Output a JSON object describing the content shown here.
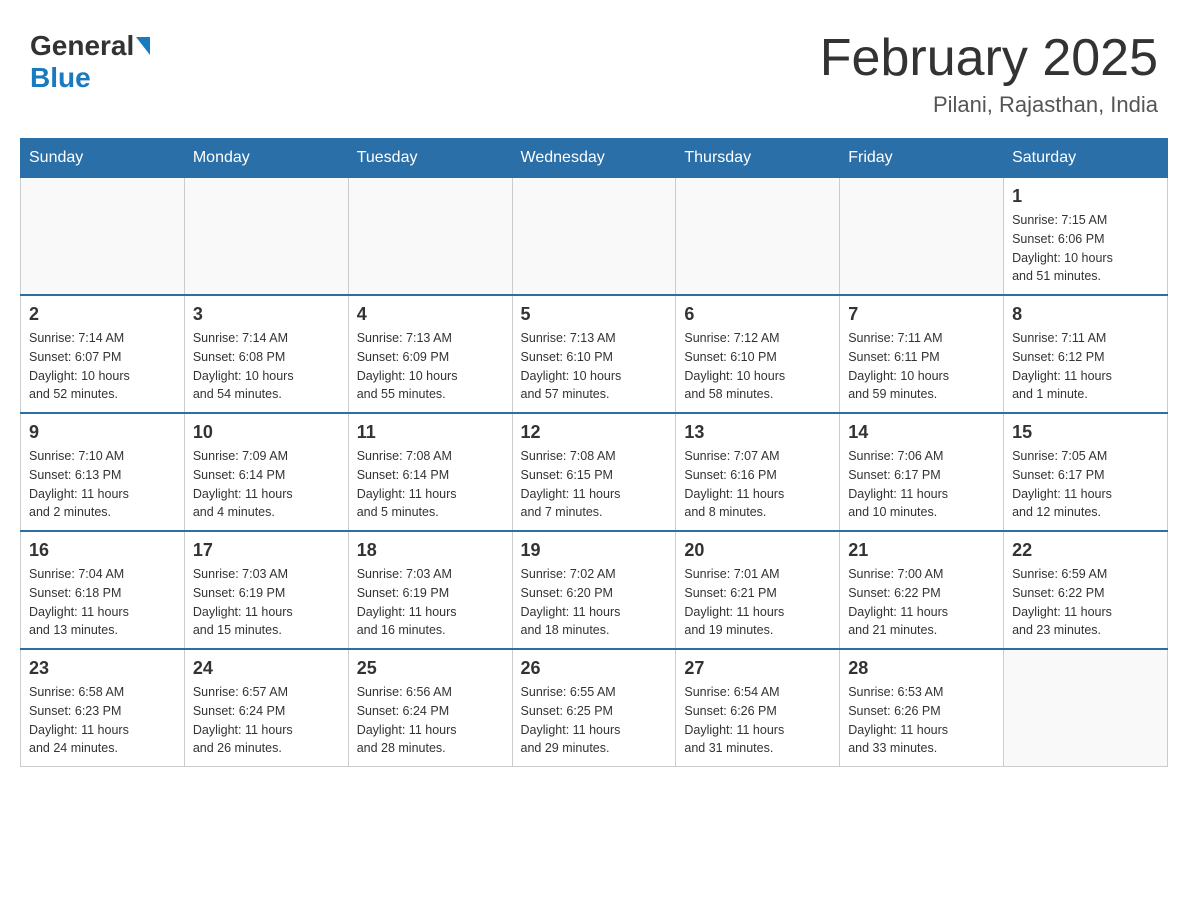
{
  "header": {
    "logo_general": "General",
    "logo_blue": "Blue",
    "month_title": "February 2025",
    "location": "Pilani, Rajasthan, India"
  },
  "days_of_week": [
    "Sunday",
    "Monday",
    "Tuesday",
    "Wednesday",
    "Thursday",
    "Friday",
    "Saturday"
  ],
  "weeks": [
    [
      {
        "day": "",
        "info": ""
      },
      {
        "day": "",
        "info": ""
      },
      {
        "day": "",
        "info": ""
      },
      {
        "day": "",
        "info": ""
      },
      {
        "day": "",
        "info": ""
      },
      {
        "day": "",
        "info": ""
      },
      {
        "day": "1",
        "info": "Sunrise: 7:15 AM\nSunset: 6:06 PM\nDaylight: 10 hours\nand 51 minutes."
      }
    ],
    [
      {
        "day": "2",
        "info": "Sunrise: 7:14 AM\nSunset: 6:07 PM\nDaylight: 10 hours\nand 52 minutes."
      },
      {
        "day": "3",
        "info": "Sunrise: 7:14 AM\nSunset: 6:08 PM\nDaylight: 10 hours\nand 54 minutes."
      },
      {
        "day": "4",
        "info": "Sunrise: 7:13 AM\nSunset: 6:09 PM\nDaylight: 10 hours\nand 55 minutes."
      },
      {
        "day": "5",
        "info": "Sunrise: 7:13 AM\nSunset: 6:10 PM\nDaylight: 10 hours\nand 57 minutes."
      },
      {
        "day": "6",
        "info": "Sunrise: 7:12 AM\nSunset: 6:10 PM\nDaylight: 10 hours\nand 58 minutes."
      },
      {
        "day": "7",
        "info": "Sunrise: 7:11 AM\nSunset: 6:11 PM\nDaylight: 10 hours\nand 59 minutes."
      },
      {
        "day": "8",
        "info": "Sunrise: 7:11 AM\nSunset: 6:12 PM\nDaylight: 11 hours\nand 1 minute."
      }
    ],
    [
      {
        "day": "9",
        "info": "Sunrise: 7:10 AM\nSunset: 6:13 PM\nDaylight: 11 hours\nand 2 minutes."
      },
      {
        "day": "10",
        "info": "Sunrise: 7:09 AM\nSunset: 6:14 PM\nDaylight: 11 hours\nand 4 minutes."
      },
      {
        "day": "11",
        "info": "Sunrise: 7:08 AM\nSunset: 6:14 PM\nDaylight: 11 hours\nand 5 minutes."
      },
      {
        "day": "12",
        "info": "Sunrise: 7:08 AM\nSunset: 6:15 PM\nDaylight: 11 hours\nand 7 minutes."
      },
      {
        "day": "13",
        "info": "Sunrise: 7:07 AM\nSunset: 6:16 PM\nDaylight: 11 hours\nand 8 minutes."
      },
      {
        "day": "14",
        "info": "Sunrise: 7:06 AM\nSunset: 6:17 PM\nDaylight: 11 hours\nand 10 minutes."
      },
      {
        "day": "15",
        "info": "Sunrise: 7:05 AM\nSunset: 6:17 PM\nDaylight: 11 hours\nand 12 minutes."
      }
    ],
    [
      {
        "day": "16",
        "info": "Sunrise: 7:04 AM\nSunset: 6:18 PM\nDaylight: 11 hours\nand 13 minutes."
      },
      {
        "day": "17",
        "info": "Sunrise: 7:03 AM\nSunset: 6:19 PM\nDaylight: 11 hours\nand 15 minutes."
      },
      {
        "day": "18",
        "info": "Sunrise: 7:03 AM\nSunset: 6:19 PM\nDaylight: 11 hours\nand 16 minutes."
      },
      {
        "day": "19",
        "info": "Sunrise: 7:02 AM\nSunset: 6:20 PM\nDaylight: 11 hours\nand 18 minutes."
      },
      {
        "day": "20",
        "info": "Sunrise: 7:01 AM\nSunset: 6:21 PM\nDaylight: 11 hours\nand 19 minutes."
      },
      {
        "day": "21",
        "info": "Sunrise: 7:00 AM\nSunset: 6:22 PM\nDaylight: 11 hours\nand 21 minutes."
      },
      {
        "day": "22",
        "info": "Sunrise: 6:59 AM\nSunset: 6:22 PM\nDaylight: 11 hours\nand 23 minutes."
      }
    ],
    [
      {
        "day": "23",
        "info": "Sunrise: 6:58 AM\nSunset: 6:23 PM\nDaylight: 11 hours\nand 24 minutes."
      },
      {
        "day": "24",
        "info": "Sunrise: 6:57 AM\nSunset: 6:24 PM\nDaylight: 11 hours\nand 26 minutes."
      },
      {
        "day": "25",
        "info": "Sunrise: 6:56 AM\nSunset: 6:24 PM\nDaylight: 11 hours\nand 28 minutes."
      },
      {
        "day": "26",
        "info": "Sunrise: 6:55 AM\nSunset: 6:25 PM\nDaylight: 11 hours\nand 29 minutes."
      },
      {
        "day": "27",
        "info": "Sunrise: 6:54 AM\nSunset: 6:26 PM\nDaylight: 11 hours\nand 31 minutes."
      },
      {
        "day": "28",
        "info": "Sunrise: 6:53 AM\nSunset: 6:26 PM\nDaylight: 11 hours\nand 33 minutes."
      },
      {
        "day": "",
        "info": ""
      }
    ]
  ]
}
